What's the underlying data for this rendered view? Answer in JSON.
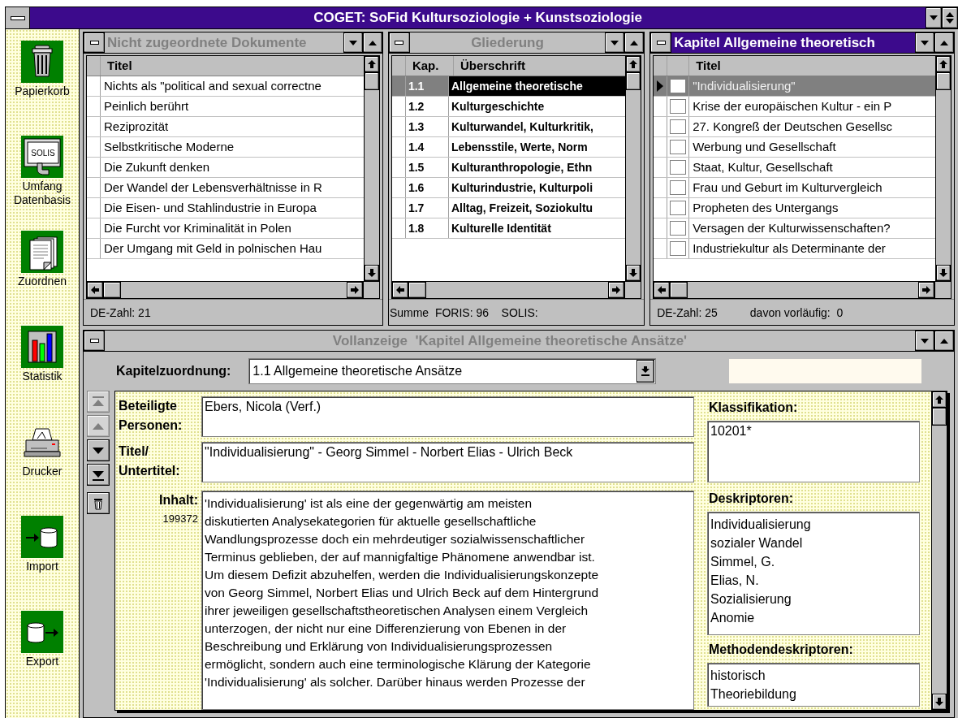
{
  "window": {
    "title": "COGET: SoFid Kultursoziologie + Kunstsoziologie"
  },
  "sidebar": {
    "items": [
      {
        "label": "Papierkorb",
        "kind": "trash"
      },
      {
        "label": "Umfang Datenbasis",
        "kind": "solis",
        "icon_text": "SOLIS"
      },
      {
        "label": "Zuordnen",
        "kind": "docs"
      },
      {
        "label": "Statistik",
        "kind": "chart"
      },
      {
        "label": "Drucker",
        "kind": "printer"
      },
      {
        "label": "Import",
        "kind": "import"
      },
      {
        "label": "Export",
        "kind": "export"
      }
    ]
  },
  "panels": [
    {
      "title": "Nicht zugeordnete Dokumente",
      "active": false,
      "kind": "plain",
      "columns": [
        "Titel"
      ],
      "rows": [
        {
          "cells": [
            "Nichts als \"political and sexual correctne"
          ],
          "selected": false
        },
        {
          "cells": [
            "Peinlich berührt"
          ],
          "selected": false
        },
        {
          "cells": [
            "Reziprozität"
          ],
          "selected": false
        },
        {
          "cells": [
            "Selbstkritische Moderne"
          ],
          "selected": false
        },
        {
          "cells": [
            "Die Zukunft denken"
          ],
          "selected": false
        },
        {
          "cells": [
            "Der Wandel der Lebensverhältnisse in R"
          ],
          "selected": false
        },
        {
          "cells": [
            "Die Eisen- und Stahlindustrie in Europa"
          ],
          "selected": false
        },
        {
          "cells": [
            "Die Furcht vor Kriminalität in Polen"
          ],
          "selected": false
        },
        {
          "cells": [
            "Der Umgang mit Geld in polnischen Hau"
          ],
          "selected": false
        }
      ],
      "footer": [
        "DE-Zahl: 21"
      ]
    },
    {
      "title": "Gliederung",
      "active": false,
      "kind": "outline",
      "columns": [
        "Kap.",
        "Überschrift"
      ],
      "rows": [
        {
          "cells": [
            "1.1",
            "Allgemeine theoretische"
          ],
          "selected": true
        },
        {
          "cells": [
            "1.2",
            "Kulturgeschichte"
          ],
          "selected": false
        },
        {
          "cells": [
            "1.3",
            "Kulturwandel, Kulturkritik,"
          ],
          "selected": false
        },
        {
          "cells": [
            "1.4",
            "Lebensstile, Werte, Norm"
          ],
          "selected": false
        },
        {
          "cells": [
            "1.5",
            "Kulturanthropologie, Ethn"
          ],
          "selected": false
        },
        {
          "cells": [
            "1.6",
            "Kulturindustrie, Kulturpoli"
          ],
          "selected": false
        },
        {
          "cells": [
            "1.7",
            "Alltag, Freizeit, Soziokultu"
          ],
          "selected": false
        },
        {
          "cells": [
            "1.8",
            "Kulturelle Identität"
          ],
          "selected": false
        }
      ],
      "footer": [
        "Summe  FORIS: 96    SOLIS:"
      ]
    },
    {
      "title": "Kapitel Allgemeine theoretisch",
      "active": true,
      "kind": "checklist",
      "columns": [
        "Titel"
      ],
      "rows": [
        {
          "cells": [
            "\"Individualisierung\""
          ],
          "selected": true,
          "checked": false
        },
        {
          "cells": [
            "Krise der europäischen Kultur - ein P"
          ],
          "selected": false,
          "checked": false
        },
        {
          "cells": [
            "27. Kongreß der Deutschen Gesellsc"
          ],
          "selected": false,
          "checked": false
        },
        {
          "cells": [
            "Werbung und Gesellschaft"
          ],
          "selected": false,
          "checked": false
        },
        {
          "cells": [
            "Staat, Kultur, Gesellschaft"
          ],
          "selected": false,
          "checked": false
        },
        {
          "cells": [
            "Frau und Geburt im Kulturvergleich"
          ],
          "selected": false,
          "checked": false
        },
        {
          "cells": [
            "Propheten des Untergangs"
          ],
          "selected": false,
          "checked": false
        },
        {
          "cells": [
            "Versagen der Kulturwissenschaften?"
          ],
          "selected": false,
          "checked": false
        },
        {
          "cells": [
            "Industriekultur als Determinante der"
          ],
          "selected": false,
          "checked": false
        }
      ],
      "footer": [
        "DE-Zahl: 25",
        "davon vorläufig:  0"
      ]
    }
  ],
  "detail": {
    "title": "Vollanzeige  'Kapitel Allgemeine theoretische Ansätze'",
    "active": false,
    "chapter": {
      "label": "Kapitelzuordnung:",
      "value": "1.1 Allgemeine theoretische Ansätze"
    },
    "nav": [
      {
        "kind": "first",
        "disabled": true
      },
      {
        "kind": "prev",
        "disabled": true
      },
      {
        "kind": "next",
        "disabled": false
      },
      {
        "kind": "last",
        "disabled": false
      },
      {
        "kind": "delete",
        "disabled": false
      }
    ],
    "fields": [
      {
        "label": "Beteiligte Personen:",
        "value": "Ebers, Nicola (Verf.)"
      },
      {
        "label": "Titel/ Untertitel:",
        "value": "\"Individualisierung\" - Georg Simmel - Norbert Elias - Ulrich Beck"
      }
    ],
    "content": {
      "label": "Inhalt:",
      "number": "199372",
      "text": "'Individualisierung' ist als eine der gegenwärtig am meisten\ndiskutierten Analysekategorien für aktuelle gesellschaftliche\nWandlungsprozesse doch ein mehrdeutiger sozialwissenschaftlicher\nTerminus geblieben, der auf mannigfaltige Phänomene anwendbar ist.\nUm diesem Defizit abzuhelfen, werden die Individualisierungskonzepte\nvon Georg Simmel, Norbert Elias und Ulrich Beck auf dem Hintergrund\nihrer jeweiligen gesellschaftstheoretischen Analysen einem Vergleich\nunterzogen, der nicht nur eine Differenzierung von Ebenen in der\nBeschreibung und Erklärung von Individualisierungsprozessen\nermöglicht, sondern auch eine terminologische Klärung der Kategorie\n'Individualisierung' als solcher. Darüber hinaus werden Prozesse der"
    },
    "classification": {
      "label": "Klassifikation:",
      "value": "10201*"
    },
    "descriptors": {
      "label": "Deskriptoren:",
      "items": [
        "Individualisierung",
        "sozialer Wandel",
        "Simmel, G.",
        "Elias, N.",
        "Sozialisierung",
        "Anomie"
      ]
    },
    "method_descriptors": {
      "label": "Methodendeskriptoren:",
      "items": [
        "historisch",
        "Theoriebildung"
      ]
    }
  }
}
